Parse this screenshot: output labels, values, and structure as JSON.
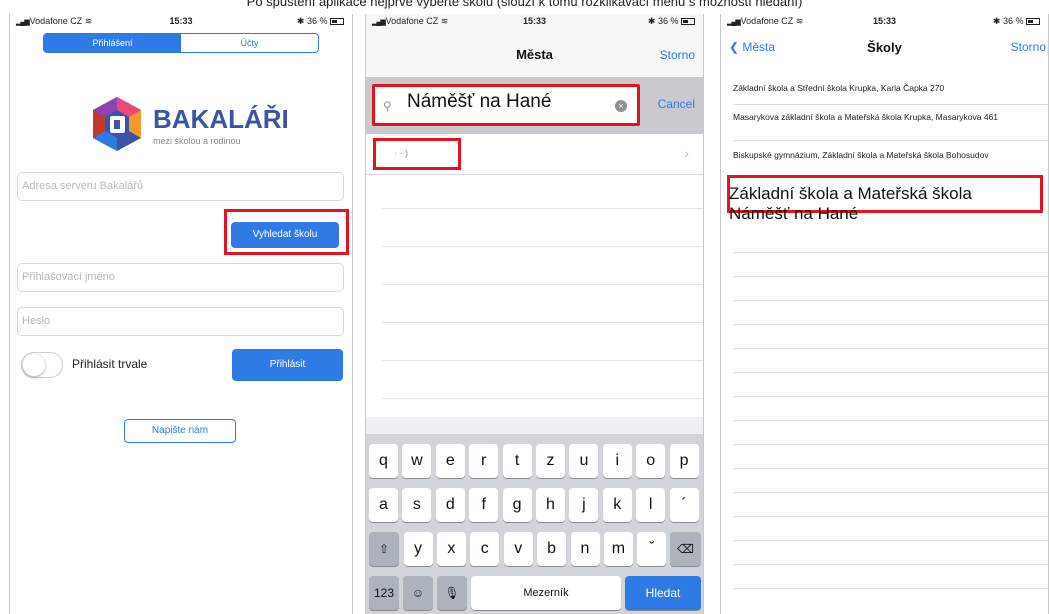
{
  "caption": "Po spuštění aplikace nejprve vyberte školu (slouží k tomu rozklikávací menu s možností hledání)",
  "status": {
    "carrier": "Vodafone CZ",
    "time": "15:33",
    "battery": "36 %"
  },
  "login_screen": {
    "tab_login": "Přihlášení",
    "tab_accounts": "Účty",
    "brand": "BAKALÁŘI",
    "brand_tagline": "mezi školou a rodinou",
    "server_placeholder": "Adresa serveru Bakalářů",
    "find_school_label": "Vyhledat školu",
    "username_placeholder": "Přihlašovací jméno",
    "password_placeholder": "Heslo",
    "remember_label": "Přihlásit trvale",
    "login_label": "Přihlásit",
    "write_us_label": "Napište nám"
  },
  "cities_screen": {
    "title": "Města",
    "cancel_nav": "Storno",
    "search_value": "Náměšť na Hané",
    "cancel_search": "Cancel",
    "result_text": "·  ·   )",
    "keyboard": {
      "row1": [
        "q",
        "w",
        "e",
        "r",
        "t",
        "z",
        "u",
        "i",
        "o",
        "p"
      ],
      "row2": [
        "a",
        "s",
        "d",
        "f",
        "g",
        "h",
        "j",
        "k",
        "l",
        "´"
      ],
      "row3": [
        "y",
        "x",
        "c",
        "v",
        "b",
        "n",
        "m",
        "ˇ"
      ],
      "numbers": "123",
      "space": "Mezerník",
      "go": "Hledat"
    }
  },
  "schools_screen": {
    "back": "Města",
    "title": "Školy",
    "cancel": "Storno",
    "schools": [
      "Základní škola a Střední škola Krupka, Karla Čapka 270",
      "Masarykova základní škola a Mateřská škola Krupka, Masarykova 461",
      "Biskupské gymnázium, Základní škola a Mateřská škola Bohosudov",
      "Základní škola a Mateřská škola Náměšť na Hané"
    ]
  },
  "colors": {
    "accent": "#2f7ae5",
    "highlight": "#e3131f",
    "brand": "#3c54a6"
  }
}
